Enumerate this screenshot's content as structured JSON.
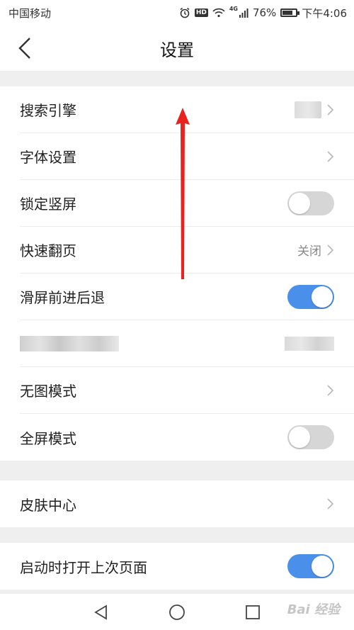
{
  "status_bar": {
    "carrier": "中国移动",
    "network": "4G",
    "battery": "76%",
    "battery_level": 0.76,
    "time": "下午4:06"
  },
  "header": {
    "title": "设置"
  },
  "section1": {
    "search_engine": "搜索引擎",
    "font_settings": "字体设置",
    "lock_portrait": "锁定竖屏",
    "lock_portrait_on": false,
    "fast_page_turn": "快速翻页",
    "fast_page_turn_value": "关闭",
    "swipe_nav": "滑屏前进后退",
    "swipe_nav_on": true,
    "no_image_mode": "无图模式",
    "fullscreen_mode": "全屏模式",
    "fullscreen_mode_on": false
  },
  "section2": {
    "skin_center": "皮肤中心"
  },
  "section3": {
    "restore_last_page": "启动时打开上次页面",
    "restore_last_page_on": true
  },
  "colors": {
    "toggle_on": "#4a8fe9",
    "toggle_off": "#d6d6d6",
    "arrow": "#e8231f"
  },
  "watermark": "Bai 经验"
}
